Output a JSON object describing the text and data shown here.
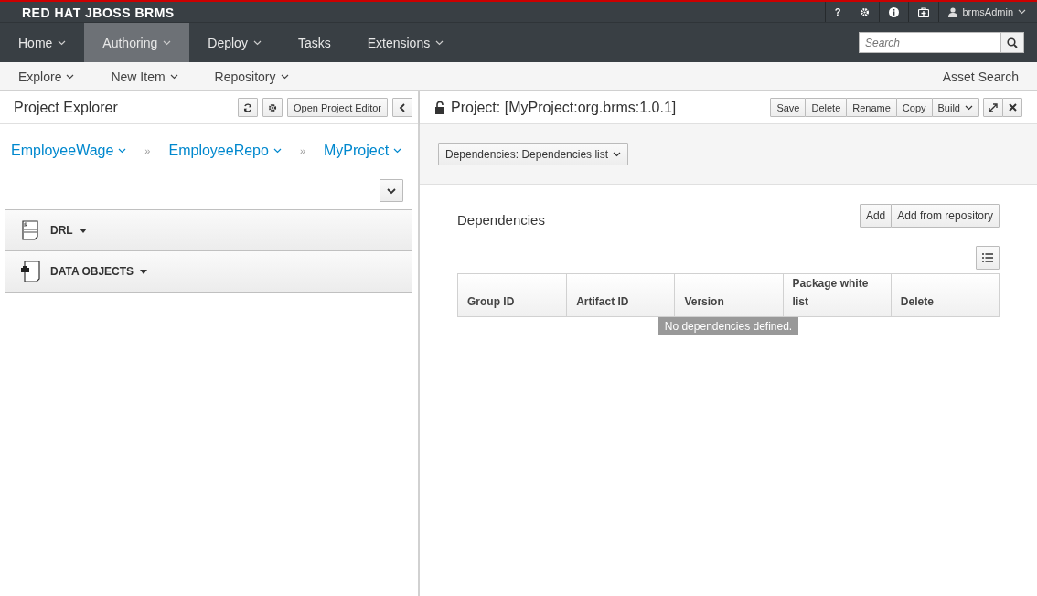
{
  "brand": "RED HAT JBOSS BRMS",
  "utility": {
    "help": "?",
    "user": "brmsAdmin"
  },
  "nav": [
    {
      "label": "Home",
      "dropdown": true,
      "selected": false
    },
    {
      "label": "Authoring",
      "dropdown": true,
      "selected": true
    },
    {
      "label": "Deploy",
      "dropdown": true,
      "selected": false
    },
    {
      "label": "Tasks",
      "dropdown": false,
      "selected": false
    },
    {
      "label": "Extensions",
      "dropdown": true,
      "selected": false
    }
  ],
  "search": {
    "placeholder": "Search"
  },
  "subnav": {
    "items": [
      "Explore",
      "New Item",
      "Repository"
    ],
    "asset_search": "Asset Search"
  },
  "explorer": {
    "title": "Project Explorer",
    "open_editor": "Open Project Editor",
    "breadcrumbs": [
      "EmployeeWage",
      "EmployeeRepo",
      "MyProject"
    ],
    "separators": [
      "»",
      "»"
    ],
    "groups": [
      {
        "label": "DRL",
        "kind": "rule"
      },
      {
        "label": "DATA OBJECTS",
        "kind": "data"
      }
    ]
  },
  "editor": {
    "title": "Project: [MyProject:org.brms:1.0.1]",
    "actions": [
      {
        "label": "Save",
        "dropdown": false
      },
      {
        "label": "Delete",
        "dropdown": false
      },
      {
        "label": "Rename",
        "dropdown": false
      },
      {
        "label": "Copy",
        "dropdown": false
      },
      {
        "label": "Build",
        "dropdown": true
      }
    ],
    "view_selector": "Dependencies: Dependencies list",
    "section_title": "Dependencies",
    "add_buttons": [
      "Add",
      "Add from repository"
    ],
    "table": {
      "columns": [
        "Group ID",
        "Artifact ID",
        "Version",
        "Package white list",
        "Delete"
      ],
      "empty_message": "No dependencies defined."
    }
  }
}
